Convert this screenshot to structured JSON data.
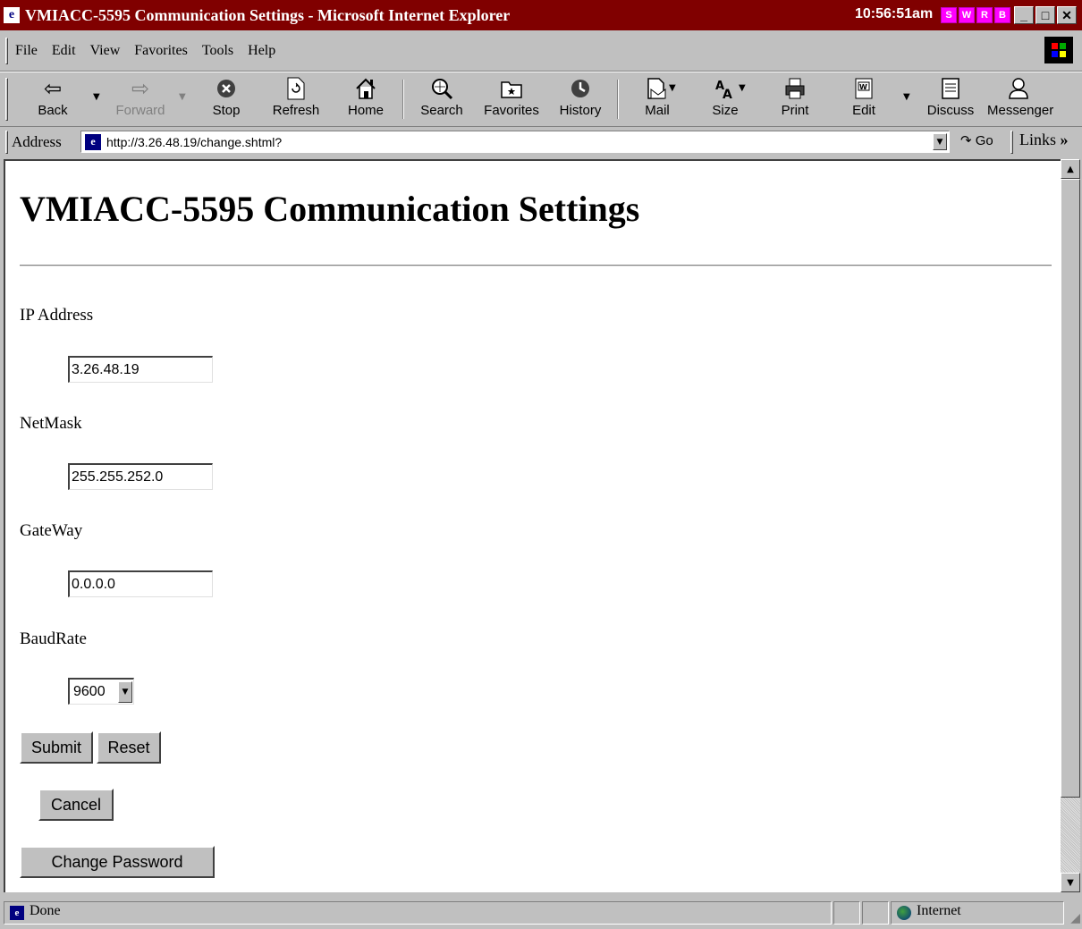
{
  "window": {
    "title": "VMIACC-5595 Communication Settings - Microsoft Internet Explorer",
    "clock": "10:56:51am",
    "tray": [
      "S",
      "W",
      "R",
      "B"
    ]
  },
  "menu": [
    "File",
    "Edit",
    "View",
    "Favorites",
    "Tools",
    "Help"
  ],
  "toolbar": {
    "back": "Back",
    "forward": "Forward",
    "stop": "Stop",
    "refresh": "Refresh",
    "home": "Home",
    "search": "Search",
    "favorites": "Favorites",
    "history": "History",
    "mail": "Mail",
    "size": "Size",
    "print": "Print",
    "edit": "Edit",
    "discuss": "Discuss",
    "messenger": "Messenger"
  },
  "address": {
    "label": "Address",
    "url": "http://3.26.48.19/change.shtml?",
    "go": "Go",
    "links": "Links"
  },
  "page": {
    "heading": "VMIACC-5595 Communication Settings",
    "fields": [
      {
        "label": "IP Address",
        "value": "3.26.48.19"
      },
      {
        "label": "NetMask",
        "value": "255.255.252.0"
      },
      {
        "label": "GateWay",
        "value": "0.0.0.0"
      }
    ],
    "baud": {
      "label": "BaudRate",
      "selected": "9600"
    },
    "buttons": {
      "submit": "Submit",
      "reset": "Reset",
      "cancel": "Cancel",
      "change_password": "Change Password"
    }
  },
  "status": {
    "text": "Done",
    "zone": "Internet"
  }
}
